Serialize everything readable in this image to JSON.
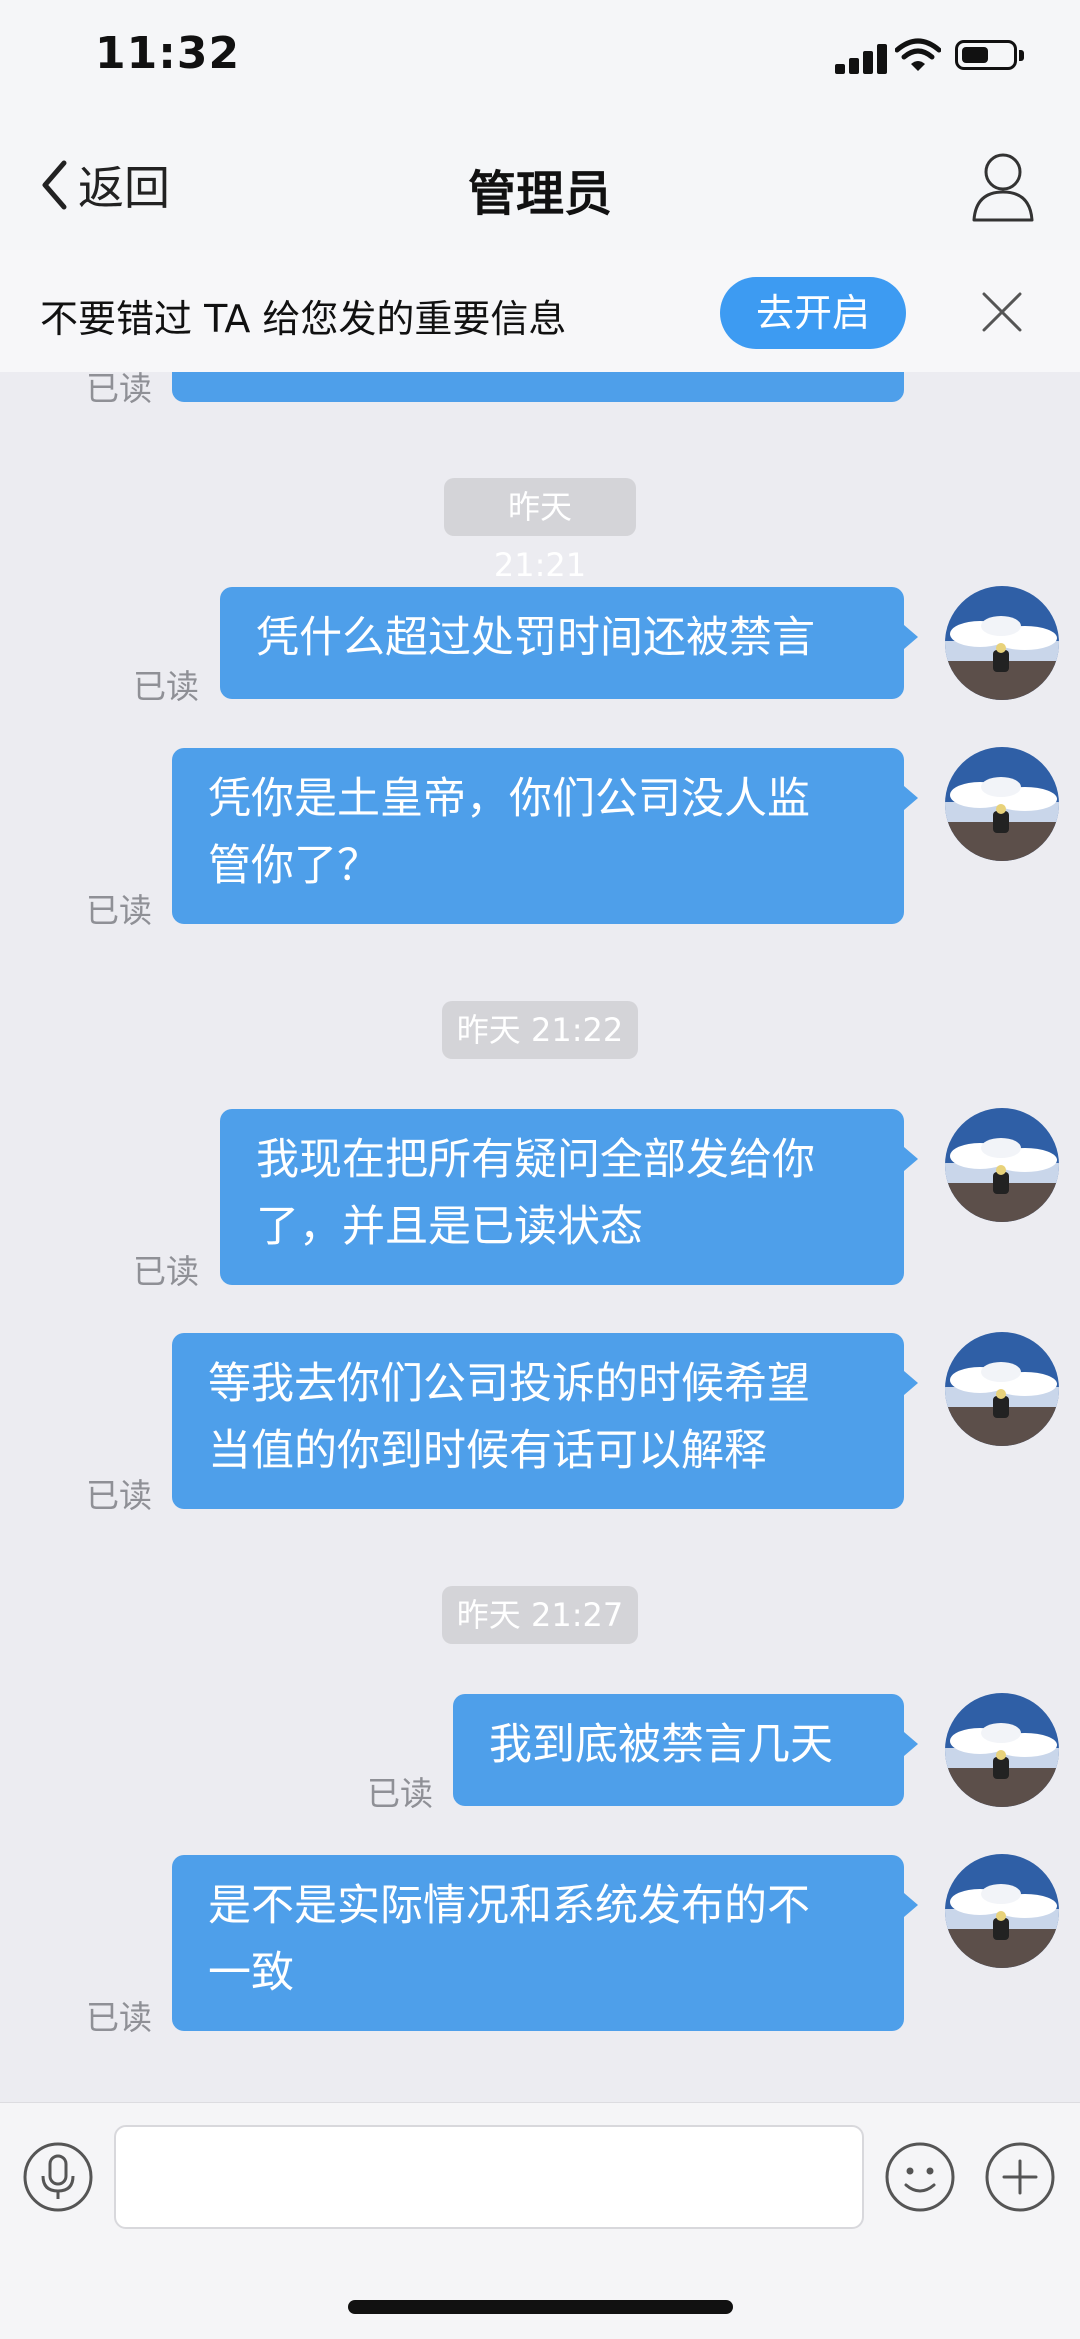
{
  "status_bar": {
    "time": "11:32",
    "battery_level": 0.55
  },
  "nav": {
    "back_label": "返回",
    "title": "管理员"
  },
  "notice": {
    "text": "不要错过 TA 给您发的重要信息",
    "button_label": "去开启"
  },
  "read_label": "已读",
  "messages": [
    {
      "time": "昨天 21:21",
      "text": "凭什么超过处罚时间还被禁言"
    },
    {
      "text": "凭你是土皇帝，你们公司没人监\n管你了？"
    },
    {
      "time": "昨天 21:22",
      "text": "我现在把所有疑问全部发给你\n了，并且是已读状态"
    },
    {
      "text": "等我去你们公司投诉的时候希望\n当值的你到时候有话可以解释"
    },
    {
      "time": "昨天 21:27",
      "text": "我到底被禁言几天"
    },
    {
      "text": "是不是实际情况和系统发布的不\n一致"
    }
  ],
  "colors": {
    "bubble": "#4e9fea",
    "accent": "#3d9bf2",
    "background": "#ececf1"
  },
  "icons": {
    "back": "chevron-left-icon",
    "profile": "user-icon",
    "close": "close-icon",
    "voice": "microphone-icon",
    "emoji": "emoji-icon",
    "more": "plus-icon"
  }
}
